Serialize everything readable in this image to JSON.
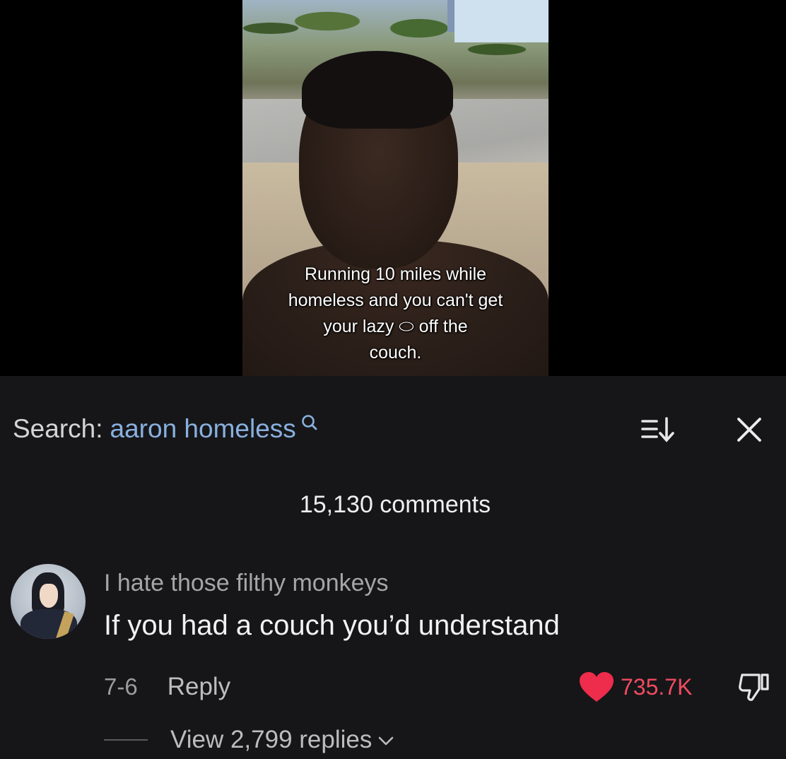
{
  "video": {
    "caption_lines": [
      "Running 10 miles while",
      "homeless and you can't get",
      "your lazy ⬭ off the",
      "couch."
    ]
  },
  "search": {
    "label": "Search:",
    "query": "aaron homeless"
  },
  "comments": {
    "count_label": "15,130 comments",
    "items": [
      {
        "username": "I hate those filthy monkeys",
        "text": "If you had a couch you’d understand",
        "date": "7-6",
        "reply_label": "Reply",
        "likes": "735.7K",
        "view_replies": "View 2,799 replies"
      }
    ]
  },
  "icons": {
    "search": "search-icon",
    "sort": "sort-icon",
    "close": "close-icon",
    "heart": "heart-icon",
    "dislike": "dislike-icon",
    "chevron": "chevron-down-icon"
  },
  "colors": {
    "panel_bg": "#161619",
    "search_query": "#89b0de",
    "like_red": "#f04b5f"
  }
}
